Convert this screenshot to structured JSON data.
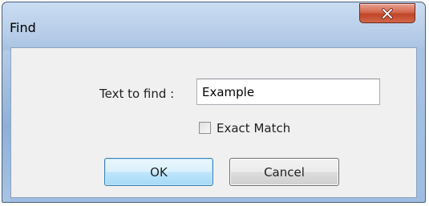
{
  "window": {
    "title": "Find",
    "close_icon": "close-icon"
  },
  "form": {
    "label": "Text to find :",
    "input_value": "Example",
    "exact_match_label": "Exact Match",
    "exact_match_checked": false
  },
  "buttons": {
    "ok_label": "OK",
    "cancel_label": "Cancel"
  },
  "colors": {
    "frame": "#b7cde8",
    "close_button": "#c14528",
    "ok_border": "#3c7fb1",
    "client_background": "#f0f0f0"
  }
}
